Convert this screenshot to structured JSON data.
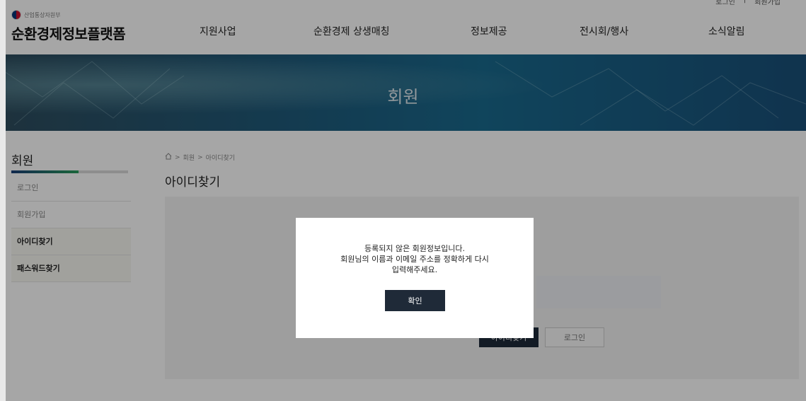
{
  "header": {
    "ministry": "산업통상자원부",
    "site_title": "순환경제정보플랫폼",
    "util": {
      "login": "로그인",
      "join": "회원가입"
    },
    "nav": [
      "지원사업",
      "순환경제 상생매칭",
      "정보제공",
      "전시회/행사",
      "소식알림"
    ]
  },
  "banner": {
    "title": "회원"
  },
  "lnb": {
    "title": "회원",
    "items": [
      {
        "label": "로그인",
        "active": false
      },
      {
        "label": "회원가입",
        "active": false
      },
      {
        "label": "아이디찾기",
        "active": true
      },
      {
        "label": "패스워드찾기",
        "active": true
      }
    ]
  },
  "breadcrumb": [
    "회원",
    "아이디찾기"
  ],
  "page_title": "아이디찾기",
  "form": {
    "find_button": "아이디찾기",
    "login_button": "로그인"
  },
  "dialog": {
    "lines": [
      "등록되지 않은 회원정보입니다.",
      "회원님의 이름과 이메일 주소를 정확하게 다시",
      "입력해주세요."
    ],
    "confirm": "확인"
  },
  "colors": {
    "primary_dark": "#1f2a38",
    "banner_blue": "#1a6a8e",
    "accent_green": "#2a9d5b"
  },
  "icons": {
    "breadcrumb_home": "home-icon",
    "ministry": "taegeuk-emblem-icon"
  }
}
